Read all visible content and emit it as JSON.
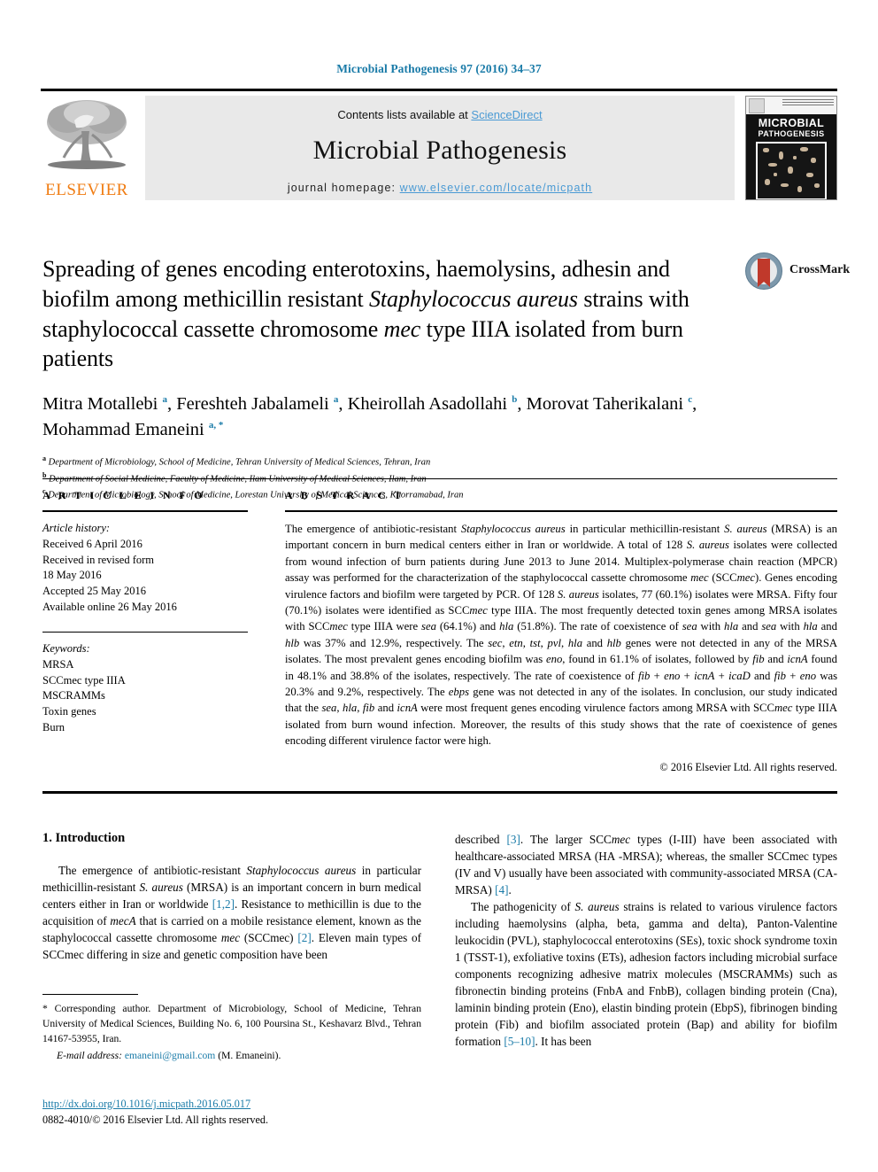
{
  "running_head": "Microbial Pathogenesis 97 (2016) 34–37",
  "masthead": {
    "contents_prefix": "Contents lists available at ",
    "sciencedirect": "ScienceDirect",
    "journal_name": "Microbial Pathogenesis",
    "homepage_prefix": "journal homepage: ",
    "homepage_url": "www.elsevier.com/locate/micpath",
    "publisher_wordmark": "ELSEVIER",
    "cover_title_line1": "MICROBIAL",
    "cover_title_line2": "PATHOGENESIS"
  },
  "crossmark": {
    "label": "CrossMark"
  },
  "article": {
    "title_html": "Spreading of genes encoding enterotoxins, haemolysins, adhesin and biofilm among methicillin resistant <em>Staphylococcus aureus</em> strains with staphylococcal cassette chromosome <em>mec</em> type IIIA isolated from burn patients",
    "authors_html": "Mitra Motallebi <sup>a</sup>, Fereshteh Jabalameli <sup>a</sup>, Kheirollah Asadollahi <sup>b</sup>, Morovat Taherikalani <sup>c</sup>, Mohammad Emaneini <sup>a,&nbsp;*</sup>",
    "affiliations_html": "<sup>a</sup> Department of Microbiology, School of Medicine, Tehran University of Medical Sciences, Tehran, Iran<br><sup>b</sup> Department of Social Medicine, Faculty of Medicine, Ilam University of Medical Sciences, Ilam, Iran<br><sup>c</sup> Department of Microbiology, School of Medicine, Lorestan University of Medical Sciences, Khorramabad, Iran"
  },
  "article_info": {
    "heading": "A R T I C L E  I N F O",
    "history_label": "Article history:",
    "history_lines": [
      "Received 6 April 2016",
      "Received in revised form",
      "18 May 2016",
      "Accepted 25 May 2016",
      "Available online 26 May 2016"
    ],
    "keywords_label": "Keywords:",
    "keywords": [
      "MRSA",
      "SCCmec type IIIA",
      "MSCRAMMs",
      "Toxin genes",
      "Burn"
    ]
  },
  "abstract": {
    "heading": "A B S T R A C T",
    "body_html": "The emergence of antibiotic-resistant <em>Staphylococcus aureus</em> in particular methicillin-resistant <em>S. aureus</em> (MRSA) is an important concern in burn medical centers either in Iran or worldwide. A total of 128 <em>S. aureus</em> isolates were collected from wound infection of burn patients during June 2013 to June 2014. Multiplex-polymerase chain reaction (MPCR) assay was performed for the characterization of the staphylococcal cassette chromosome <em>mec</em> (SCC<em>mec</em>). Genes encoding virulence factors and biofilm were targeted by PCR. Of 128 <em>S. aureus</em> isolates, 77 (60.1%) isolates were MRSA. Fifty four (70.1%) isolates were identified as SCC<em>mec</em> type IIIA. The most frequently detected toxin genes among MRSA isolates with SCC<em>mec</em> type IIIA were <em>sea</em> (64.1%) and <em>hla</em> (51.8%). The rate of coexistence of <em>sea</em> with <em>hla</em> and <em>sea</em> with <em>hla</em> and <em>hlb</em> was 37% and 12.9%, respectively. The <em>sec</em>, <em>etn</em>, <em>tst</em>, <em>pvl</em>, <em>hla</em> and <em>hlb</em> genes were not detected in any of the MRSA isolates. The most prevalent genes encoding biofilm was <em>eno</em>, found in 61.1% of isolates, followed by <em>fib</em> and <em>icnA</em> found in 48.1% and 38.8% of the isolates, respectively. The rate of coexistence of <em>fib</em> + <em>eno</em> + <em>icnA</em> + <em>icaD</em> and <em>fib</em> + <em>eno</em> was 20.3% and 9.2%, respectively. The <em>ebps</em> gene was not detected in any of the isolates. In conclusion, our study indicated that the <em>sea</em>, <em>hla</em>, <em>fib</em> and <em>icnA</em> were most frequent genes encoding virulence factors among MRSA with SCC<em>mec</em> type IIIA isolated from burn wound infection. Moreover, the results of this study shows that the rate of coexistence of genes encoding different virulence factor were high.",
    "copyright": "© 2016 Elsevier Ltd. All rights reserved."
  },
  "introduction": {
    "heading": "1. Introduction",
    "left_paragraph_html": "The emergence of antibiotic-resistant <em>Staphylococcus aureus</em> in particular methicillin-resistant <em>S. aureus</em> (MRSA) is an important concern in burn medical centers either in Iran or worldwide <span class=\"ref\">[1,2]</span>. Resistance to methicillin is due to the acquisition of <em>mecA</em> that is carried on a mobile resistance element, known as the staphylococcal cassette chromosome <em>mec</em> (SCCmec) <span class=\"ref\">[2]</span>. Eleven main types of SCCmec differing in size and genetic composition have been",
    "right_paragraph1_html": "described <span class=\"ref\">[3]</span>. The larger SCC<em>mec</em> types (I-III) have been associated with healthcare-associated MRSA (HA -MRSA); whereas, the smaller SCCmec types (IV and V) usually have been associated with community-associated MRSA (CA-MRSA) <span class=\"ref\">[4]</span>.",
    "right_paragraph2_html": "The pathogenicity of <em>S. aureus</em> strains is related to various virulence factors including haemolysins (alpha, beta, gamma and delta), Panton-Valentine leukocidin (PVL), staphylococcal enterotoxins (SEs), toxic shock syndrome toxin 1 (TSST-1), exfoliative toxins (ETs), adhesion factors including microbial surface components recognizing adhesive matrix molecules (MSCRAMMs) such as fibronectin binding proteins (FnbA and FnbB), collagen binding protein (Cna), laminin binding protein (Eno), elastin binding protein (EbpS), fibrinogen binding protein (Fib) and biofilm associated protein (Bap) and ability for biofilm formation <span class=\"ref\">[5&ndash;10]</span>. It has been"
  },
  "footnote": {
    "corresponding_html": "<span class=\"star\">*</span> Corresponding author. Department of Microbiology, School of Medicine, Tehran University of Medical Sciences, Building No. 6, 100 Poursina St., Keshavarz Blvd., Tehran 14167-53955, Iran.",
    "email_label": "E-mail address:",
    "email": "emaneini@gmail.com",
    "email_suffix": "(M. Emaneini)."
  },
  "doi": {
    "url": "http://dx.doi.org/10.1016/j.micpath.2016.05.017",
    "issn_line": "0882-4010/© 2016 Elsevier Ltd. All rights reserved."
  },
  "colors": {
    "link_blue": "#1a7ba8",
    "light_blue": "#4a9ad4",
    "elsevier_orange": "#f07c12",
    "crossmark_red": "#c0392b",
    "masthead_gray": "#e9e9e9"
  }
}
